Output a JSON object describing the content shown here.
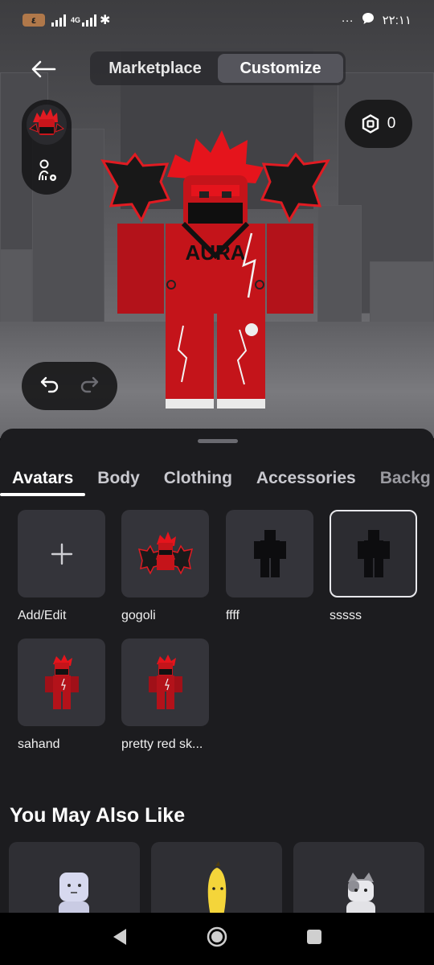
{
  "status_bar": {
    "battery": "٤",
    "network": "4G",
    "time": "٢٢:١١",
    "more": "···"
  },
  "header": {
    "tabs": [
      {
        "label": "Marketplace",
        "active": false
      },
      {
        "label": "Customize",
        "active": true
      }
    ],
    "robux_count": "0"
  },
  "avatar_preview": {
    "shirt_text": "AURA"
  },
  "sheet": {
    "category_tabs": [
      {
        "label": "Avatars",
        "active": true
      },
      {
        "label": "Body",
        "active": false
      },
      {
        "label": "Clothing",
        "active": false
      },
      {
        "label": "Accessories",
        "active": false
      },
      {
        "label": "Backg",
        "active": false
      }
    ],
    "avatars": [
      {
        "name": "Add/Edit",
        "icon": "plus-icon"
      },
      {
        "name": "gogoli",
        "icon": "avatar-thumbnail"
      },
      {
        "name": "ffff",
        "icon": "avatar-silhouette-icon"
      },
      {
        "name": "sssss",
        "icon": "avatar-silhouette-icon",
        "selected": true
      },
      {
        "name": "sahand",
        "icon": "avatar-thumbnail"
      },
      {
        "name": "pretty red sk...",
        "icon": "avatar-thumbnail"
      }
    ],
    "recommend_title": "You May Also Like"
  },
  "colors": {
    "sheet_bg": "#1c1c1f",
    "tile_bg": "#34343a",
    "accent_red": "#d8141c"
  }
}
